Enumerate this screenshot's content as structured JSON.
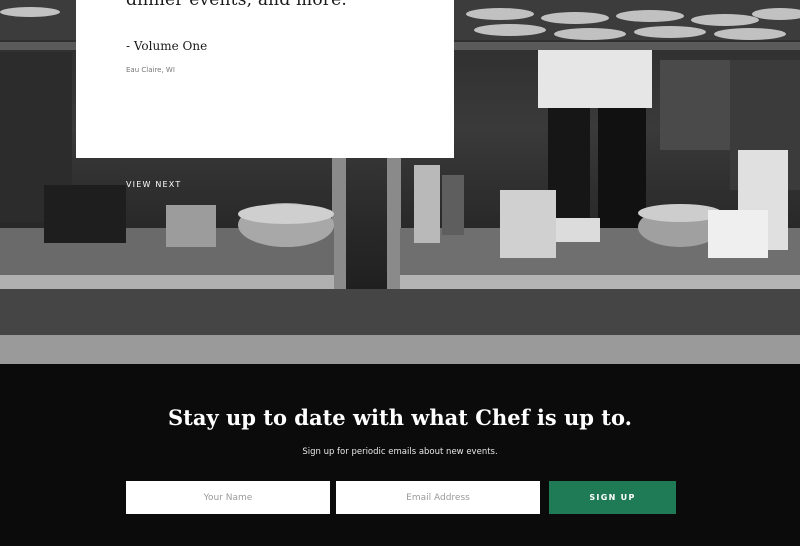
{
  "hero": {
    "card": {
      "text_line": "dinner events, and more.",
      "quote_author": "- Volume One",
      "location": "Eau Claire, WI"
    },
    "view_next_label": "VIEW NEXT"
  },
  "signup": {
    "title": "Stay up to date with what Chef is up to.",
    "subtitle": "Sign up for periodic emails about new events.",
    "name_placeholder": "Your Name",
    "email_placeholder": "Email Address",
    "name_value": "",
    "email_value": "",
    "button_label": "SIGN UP"
  },
  "colors": {
    "button": "#1f7a56",
    "footer_background": "#0b0b0b",
    "card_background": "#ffffff"
  }
}
